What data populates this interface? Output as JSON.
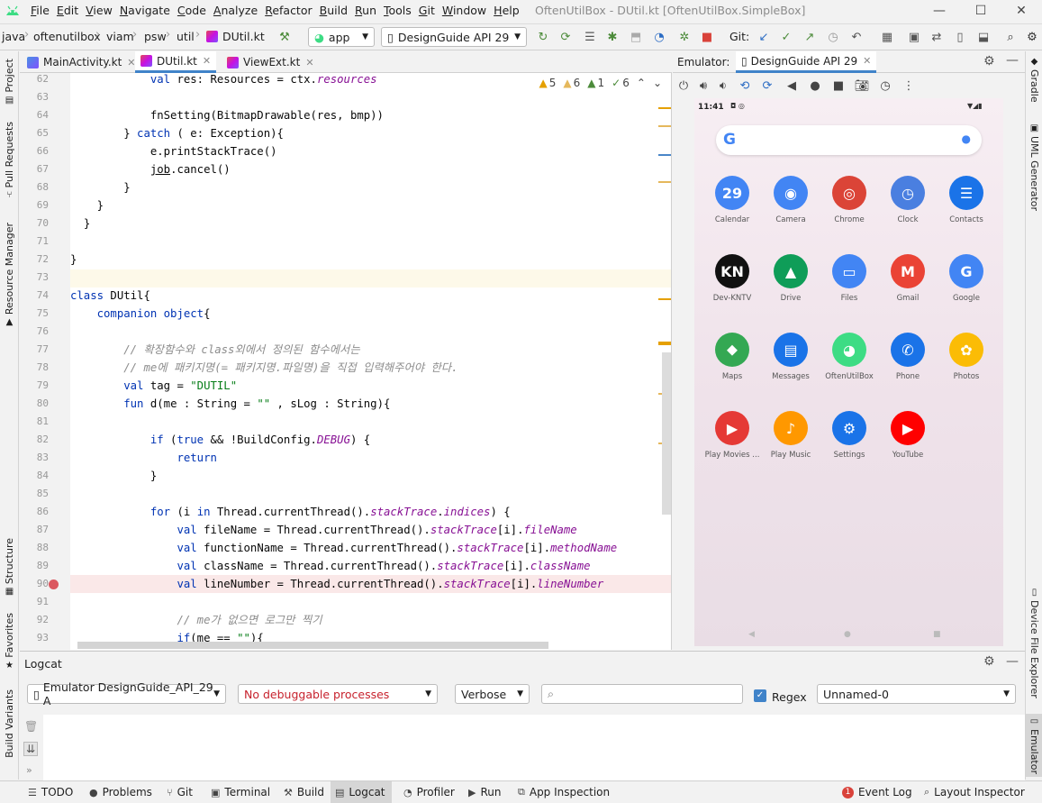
{
  "menu": [
    "File",
    "Edit",
    "View",
    "Navigate",
    "Code",
    "Analyze",
    "Refactor",
    "Build",
    "Run",
    "Tools",
    "Git",
    "Window",
    "Help"
  ],
  "window_title": "OftenUtilBox - DUtil.kt [OftenUtilBox.SimpleBox]",
  "breadcrumb": [
    "java",
    "oftenutilbox",
    "viam",
    "psw",
    "util",
    "DUtil.kt"
  ],
  "run_config": "app",
  "device": "DesignGuide API 29",
  "git_label": "Git:",
  "editor_tabs": [
    "MainActivity.kt",
    "DUtil.kt",
    "ViewExt.kt"
  ],
  "inspections": {
    "warn5": "5",
    "warn6": "6",
    "weak1": "1",
    "ok6": "6"
  },
  "code": [
    {
      "n": "62",
      "i": "            ",
      "p": [
        [
          "val",
          "kw"
        ],
        " res: Resources = ctx.",
        [
          "resources",
          "it"
        ]
      ]
    },
    {
      "n": "63",
      "i": "",
      "p": []
    },
    {
      "n": "64",
      "i": "            ",
      "p": [
        "fnSetting(BitmapDrawable(res, bmp))"
      ]
    },
    {
      "n": "65",
      "i": "        ",
      "p": [
        "} ",
        [
          "catch",
          "kw"
        ],
        " ( e: Exception){"
      ]
    },
    {
      "n": "66",
      "i": "            ",
      "p": [
        "e.printStackTrace()"
      ]
    },
    {
      "n": "67",
      "i": "            ",
      "p": [
        [
          "job",
          "ul"
        ],
        ".cancel()"
      ]
    },
    {
      "n": "68",
      "i": "        ",
      "p": [
        "}"
      ]
    },
    {
      "n": "69",
      "i": "    ",
      "p": [
        "}"
      ]
    },
    {
      "n": "70",
      "i": "  ",
      "p": [
        "}"
      ]
    },
    {
      "n": "71",
      "i": "",
      "p": []
    },
    {
      "n": "72",
      "i": "",
      "p": [
        "}"
      ]
    },
    {
      "n": "73",
      "i": "",
      "p": []
    },
    {
      "n": "74",
      "i": "",
      "p": [
        [
          "class",
          "kw"
        ],
        " DUtil{"
      ]
    },
    {
      "n": "75",
      "i": "    ",
      "p": [
        [
          "companion object",
          "kw"
        ],
        "{"
      ]
    },
    {
      "n": "76",
      "i": "",
      "p": []
    },
    {
      "n": "77",
      "i": "        ",
      "p": [
        [
          "// 확장함수와 class외에서 정의된 함수에서는",
          "cm"
        ]
      ]
    },
    {
      "n": "78",
      "i": "        ",
      "p": [
        [
          "// me에 패키지명(= 패키지명.파일명)을 직접 입력해주어야 한다.",
          "cm"
        ]
      ]
    },
    {
      "n": "79",
      "i": "        ",
      "p": [
        [
          "val",
          "kw"
        ],
        " tag = ",
        [
          "\"DUTIL\"",
          "st"
        ]
      ]
    },
    {
      "n": "80",
      "i": "        ",
      "p": [
        [
          "fun",
          "kw"
        ],
        " d(me : String = ",
        [
          "\"\"",
          "st"
        ],
        " , sLog : String){"
      ]
    },
    {
      "n": "81",
      "i": "",
      "p": []
    },
    {
      "n": "82",
      "i": "            ",
      "p": [
        [
          "if",
          "kw"
        ],
        " (",
        [
          "true",
          "kw"
        ],
        " && !BuildConfig.",
        [
          "DEBUG",
          "it"
        ],
        ") {"
      ]
    },
    {
      "n": "83",
      "i": "                ",
      "p": [
        [
          "return",
          "kw"
        ]
      ]
    },
    {
      "n": "84",
      "i": "            ",
      "p": [
        "}"
      ]
    },
    {
      "n": "85",
      "i": "",
      "p": []
    },
    {
      "n": "86",
      "i": "            ",
      "p": [
        [
          "for",
          "kw"
        ],
        " (i ",
        [
          "in",
          "kw"
        ],
        " Thread.currentThread().",
        [
          "stackTrace",
          "it"
        ],
        ".",
        [
          "indices",
          "it"
        ],
        ") {"
      ]
    },
    {
      "n": "87",
      "i": "                ",
      "p": [
        [
          "val",
          "kw"
        ],
        " fileName = Thread.currentThread().",
        [
          "stackTrace",
          "it"
        ],
        "[i].",
        [
          "fileName",
          "it"
        ]
      ]
    },
    {
      "n": "88",
      "i": "                ",
      "p": [
        [
          "val",
          "kw"
        ],
        " functionName = Thread.currentThread().",
        [
          "stackTrace",
          "it"
        ],
        "[i].",
        [
          "methodName",
          "it"
        ]
      ]
    },
    {
      "n": "89",
      "i": "                ",
      "p": [
        [
          "val",
          "kw"
        ],
        " className = Thread.currentThread().",
        [
          "stackTrace",
          "it"
        ],
        "[i].",
        [
          "className",
          "it"
        ]
      ]
    },
    {
      "n": "90",
      "i": "                ",
      "p": [
        [
          "val",
          "kw"
        ],
        " lineNumber = Thread.currentThread().",
        [
          "stackTrace",
          "it"
        ],
        "[i].",
        [
          "lineNumber",
          "it"
        ]
      ]
    },
    {
      "n": "91",
      "i": "",
      "p": []
    },
    {
      "n": "92",
      "i": "                ",
      "p": [
        [
          "// me가 없으면 로그만 찍기",
          "cm"
        ]
      ]
    },
    {
      "n": "93",
      "i": "                ",
      "p": [
        [
          "if",
          "kw"
        ],
        "(me == ",
        [
          "\"\"",
          "st"
        ],
        "){"
      ]
    }
  ],
  "emulator": {
    "label": "Emulator:",
    "tab": "DesignGuide API 29",
    "time": "11:41",
    "apps": [
      {
        "label": "Calendar",
        "glyph": "29",
        "color": "#4285f4"
      },
      {
        "label": "Camera",
        "glyph": "◉",
        "color": "#4285f4"
      },
      {
        "label": "Chrome",
        "glyph": "◎",
        "color": "#db4437"
      },
      {
        "label": "Clock",
        "glyph": "◷",
        "color": "#4a7fe0"
      },
      {
        "label": "Contacts",
        "glyph": "☰",
        "color": "#1a73e8"
      },
      {
        "label": "Dev-KNTV",
        "glyph": "KN",
        "color": "#111111"
      },
      {
        "label": "Drive",
        "glyph": "▲",
        "color": "#0f9d58"
      },
      {
        "label": "Files",
        "glyph": "▭",
        "color": "#4285f4"
      },
      {
        "label": "Gmail",
        "glyph": "M",
        "color": "#ea4335"
      },
      {
        "label": "Google",
        "glyph": "G",
        "color": "#4285f4"
      },
      {
        "label": "Maps",
        "glyph": "⬥",
        "color": "#34a853"
      },
      {
        "label": "Messages",
        "glyph": "▤",
        "color": "#1a73e8"
      },
      {
        "label": "OftenUtilBox",
        "glyph": "◕",
        "color": "#3ddc84"
      },
      {
        "label": "Phone",
        "glyph": "✆",
        "color": "#1a73e8"
      },
      {
        "label": "Photos",
        "glyph": "✿",
        "color": "#fbbc05"
      },
      {
        "label": "Play Movies ...",
        "glyph": "▶",
        "color": "#e53935"
      },
      {
        "label": "Play Music",
        "glyph": "♪",
        "color": "#ff9800"
      },
      {
        "label": "Settings",
        "glyph": "⚙",
        "color": "#1a73e8"
      },
      {
        "label": "YouTube",
        "glyph": "▶",
        "color": "#ff0000"
      }
    ]
  },
  "left_tabs": [
    "Project",
    "Pull Requests",
    "Resource Manager",
    "Structure",
    "Favorites",
    "Build Variants"
  ],
  "right_tabs": [
    "Gradle",
    "UML Generator",
    "Device File Explorer",
    "Emulator"
  ],
  "logcat": {
    "title": "Logcat",
    "device": "Emulator DesignGuide_API_29 A",
    "process": "No debuggable processes",
    "level": "Verbose",
    "search_placeholder": "",
    "regex": "Regex",
    "filter": "Unnamed-0"
  },
  "status_tabs": [
    "TODO",
    "Problems",
    "Git",
    "Terminal",
    "Build",
    "Logcat",
    "Profiler",
    "Run",
    "App Inspection"
  ],
  "status_right": [
    "Event Log",
    "Layout Inspector"
  ],
  "event_count": "1"
}
